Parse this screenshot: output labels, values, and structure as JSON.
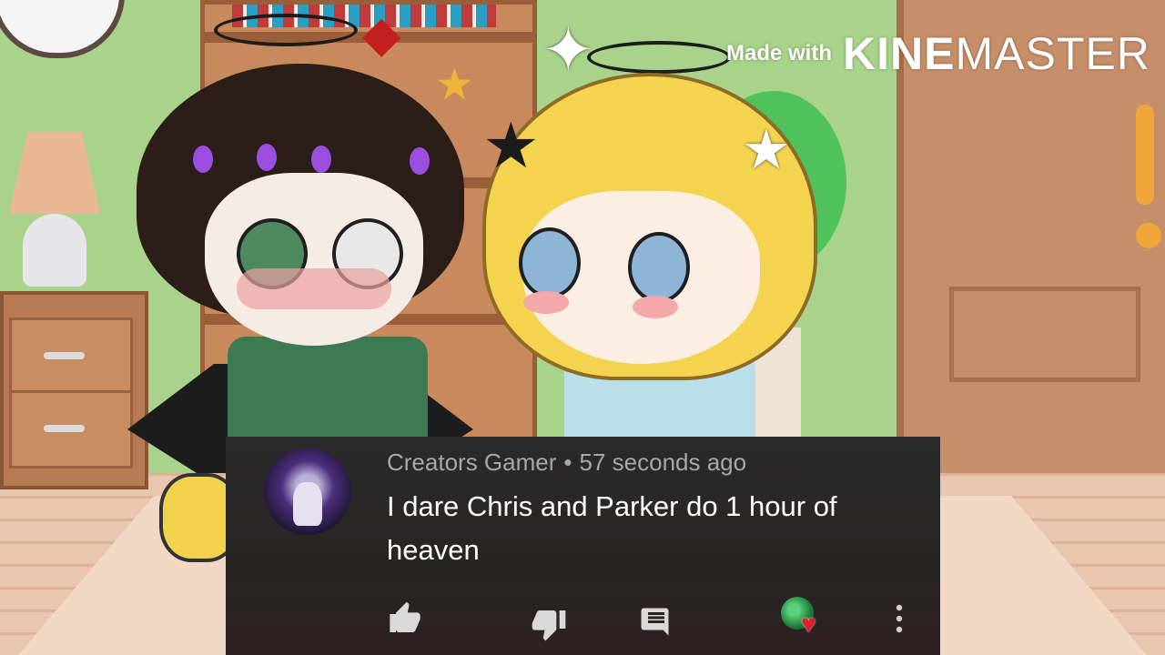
{
  "watermark": {
    "prefix": "Made with",
    "brand_first": "KINE",
    "brand_rest": "MASTER"
  },
  "comment": {
    "author": "Creators Gamer",
    "separator": "•",
    "time": "57 seconds ago",
    "text": "I dare Chris and Parker do 1 hour of heaven",
    "avatar_icon": "user-avatar",
    "actions": [
      {
        "name": "like",
        "icon": "thumbs-up-icon"
      },
      {
        "name": "dislike",
        "icon": "thumbs-down-icon"
      },
      {
        "name": "reply",
        "icon": "comment-icon"
      },
      {
        "name": "creator-heart",
        "icon": "heart-icon"
      },
      {
        "name": "more",
        "icon": "more-vertical-icon"
      }
    ]
  },
  "colors": {
    "card_bg": "#2a2a2a",
    "meta_text": "#a8a8a8",
    "body_text": "#ffffff",
    "heart": "#e21d2c"
  }
}
